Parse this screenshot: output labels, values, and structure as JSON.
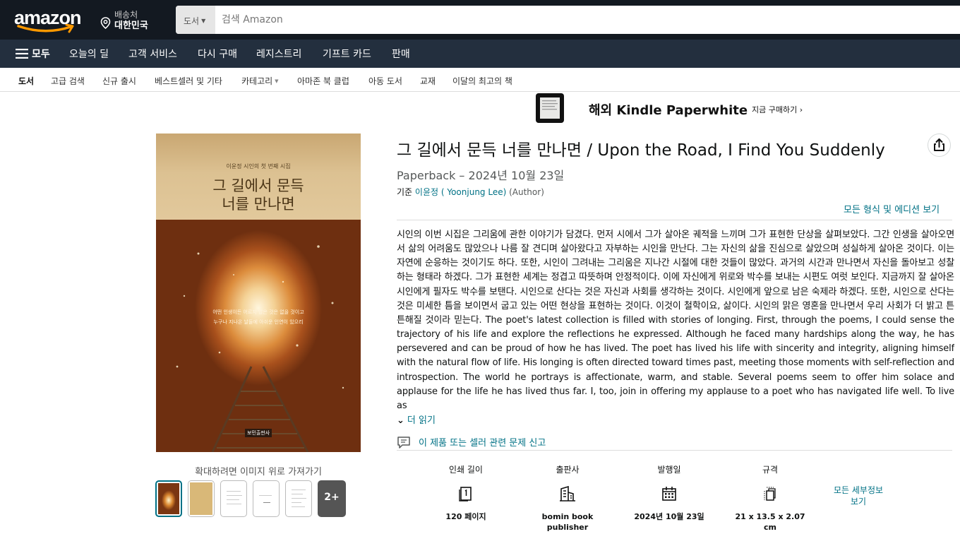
{
  "header": {
    "logo_text": "amazon",
    "deliver_line1": "배송처",
    "deliver_line2": "대한민국",
    "search_category": "도서",
    "search_placeholder": "검색 Amazon"
  },
  "main_nav": {
    "all_label": "모두",
    "items": [
      "오늘의 딜",
      "고객 서비스",
      "다시 구매",
      "레지스트리",
      "기프트 카드",
      "판매"
    ]
  },
  "sub_nav": {
    "items": [
      "도서",
      "고급 검색",
      "신규 출시",
      "베스트셀러 및 기타",
      "카테고리",
      "아마존 북 클럽",
      "아동 도서",
      "교재",
      "이달의 최고의 책"
    ]
  },
  "banner": {
    "title": "해외 Kindle Paperwhite",
    "cta": "지금 구매하기 ›"
  },
  "cover": {
    "series": "이윤정 시인의 첫 번째 시집",
    "title_line1": "그 길에서 문득",
    "title_line2": "너를 만나면",
    "body_line1": "어떤 인생이든 어르지 않은 것은 없을 것이고",
    "body_line2": "누구나 지나온 날들에 아쉬운 인연이 있으리",
    "publisher": "보민출판사"
  },
  "gallery": {
    "zoom_hint": "확대하려면 이미지 위로 가져가기",
    "more_label": "2+"
  },
  "product": {
    "title": "그 길에서 문득 너를 만나면 / Upon the Road, I Find You Suddenly",
    "format_line": "Paperback – 2024년 10월 23일",
    "by_prefix": "기준",
    "author": "이윤정 ( Yoonjung Lee)",
    "author_role": "(Author)",
    "all_formats": "모든 형식 및 에디션 보기",
    "description": "시인의 이번 시집은 그리움에 관한 이야기가 담겼다. 먼저 시에서 그가 살아온 궤적을 느끼며 그가 표현한 단상을 살펴보았다. 그간 인생을 살아오면서 삶의 어려움도 많았으나 나름 잘 견디며 살아왔다고 자부하는 시인을 만난다. 그는 자신의 삶을 진심으로 살았으며 성실하게 살아온 것이다. 이는 자연에 순응하는 것이기도 하다. 또한, 시인이 그려내는 그리움은 지나간 시절에 대한 것들이 많았다. 과거의 시간과 만나면서 자신을 돌아보고 성찰하는 형태라 하겠다. 그가 표현한 세계는 정겹고 따뜻하며 안정적이다. 이에 자신에게 위로와 박수를 보내는 시편도 여럿 보인다. 지금까지 잘 살아온 시인에게 필자도 박수를 보탠다. 시인으로 산다는 것은 자신과 사회를 생각하는 것이다. 시인에게 앞으로 남은 숙제라 하겠다. 또한, 시인으로 산다는 것은 미세한 틈을 보이면서 굽고 있는 어떤 현상을 표현하는 것이다. 이것이 철학이요, 삶이다. 시인의 맑은 영혼을 만나면서 우리 사회가 더 밝고 튼튼해질 것이라 믿는다. The poet's latest collection is filled with stories of longing. First, through the poems, I could sense the trajectory of his life and explore the reflections he expressed. Although he faced many hardships along the way, he has persevered and can be proud of how he has lived. The poet has lived his life with sincerity and integrity, aligning himself with the natural flow of life. His longing is often directed toward times past, meeting those moments with self-reflection and introspection. The world he portrays is affectionate, warm, and stable. Several poems seem to offer him solace and applause for the life he has lived thus far. I, too, join in offering my applause to a poet who has navigated life well. To live as",
    "read_more": "더 읽기",
    "report": "이 제품 또는 셀러 관련 문제 신고"
  },
  "details": {
    "items": [
      {
        "label": "인쇄 길이",
        "icon": "book-pages-icon",
        "value": "120 페이지"
      },
      {
        "label": "출판사",
        "icon": "building-icon",
        "value": "bomin book publisher"
      },
      {
        "label": "발행일",
        "icon": "calendar-icon",
        "value": "2024년 10월 23일"
      },
      {
        "label": "규격",
        "icon": "dimensions-icon",
        "value": "21 x 13.5 x 2.07 cm"
      }
    ],
    "more_label": "모든 세부정보 보기"
  },
  "colors": {
    "nav_dark": "#131921",
    "nav_secondary": "#232f3e",
    "link": "#007185",
    "logo_smile": "#ff9900"
  }
}
